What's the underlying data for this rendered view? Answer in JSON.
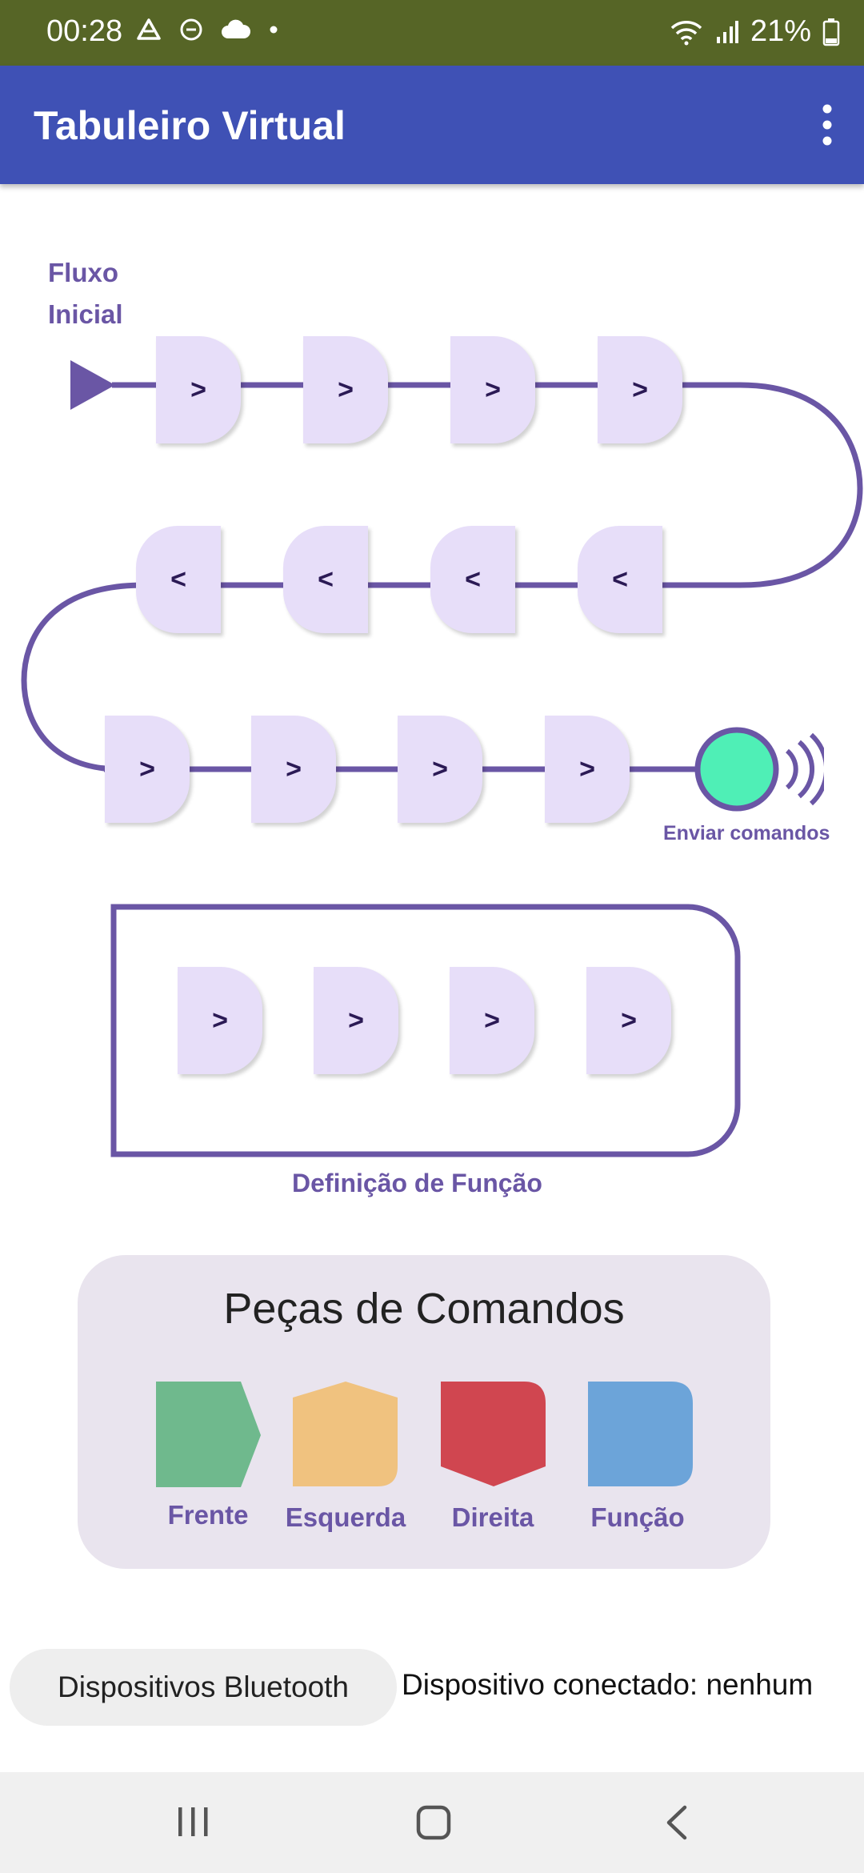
{
  "status_bar": {
    "time": "00:28",
    "battery": "21%"
  },
  "app_bar": {
    "title": "Tabuleiro Virtual"
  },
  "flow": {
    "label_line1": "Fluxo",
    "label_line2": "Inicial",
    "row1": [
      ">",
      ">",
      ">",
      ">"
    ],
    "row2": [
      "<",
      "<",
      "<",
      "<"
    ],
    "row3": [
      ">",
      ">",
      ">",
      ">"
    ],
    "send_label": "Enviar comandos"
  },
  "function": {
    "pieces": [
      ">",
      ">",
      ">",
      ">"
    ],
    "label": "Definição de Função"
  },
  "palette": {
    "title": "Peças de Comandos",
    "items": [
      {
        "label": "Frente",
        "color": "#6fb98d"
      },
      {
        "label": "Esquerda",
        "color": "#f0c27f"
      },
      {
        "label": "Direita",
        "color": "#d04650"
      },
      {
        "label": "Função",
        "color": "#6ca4d9"
      }
    ]
  },
  "bluetooth": {
    "button_label": "Dispositivos Bluetooth",
    "status_text": "Dispositivo conectado: nenhum"
  },
  "colors": {
    "accent": "#6a56a5",
    "send_button": "#4fefb6",
    "app_bar": "#3f51b5"
  }
}
